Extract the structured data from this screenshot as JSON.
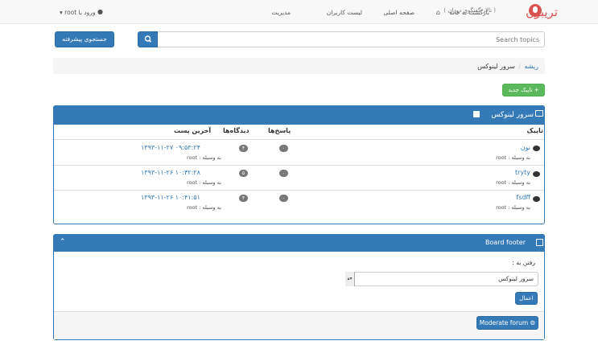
{
  "navbar": {
    "brand": "تریبون",
    "tagline": "( تالار گفتگوی دوران )",
    "items": [
      {
        "label": "بازگشت به خانه",
        "icon": "home-icon"
      },
      {
        "label": "صفحه اصلی"
      },
      {
        "label": "لیست کاربران"
      },
      {
        "label": "مدیریت"
      }
    ],
    "login": "ورود با root ▾",
    "user_icon": "user-icon"
  },
  "search": {
    "placeholder": "Search topics",
    "advanced_label": "جستجوی پیشرفته"
  },
  "breadcrumb": {
    "root": "ریشه",
    "separator": "/",
    "current": "سرور لینوکس"
  },
  "new_topic_label": "+ تاپیک جدید",
  "forum": {
    "title": "سرور لینوکس",
    "columns": {
      "topic": "تاپیک",
      "replies": "پاسخ‌ها",
      "views": "دیدگاه‌ها",
      "last_post": "آخرین پست"
    },
    "rows": [
      {
        "title": "نون",
        "by": "به وسیله : root",
        "replies": "۰",
        "views": "۴",
        "last_date": "۱۳۹۳-۱۱-۲۷ ۰۹:۵۳:۲۴",
        "last_by": "به وسیله : root"
      },
      {
        "title": "tryty",
        "by": "به وسیله : root",
        "replies": "۰",
        "views": "۵",
        "last_date": "۱۳۹۳-۱۱-۲۶ ۱۰:۴۲:۲۸",
        "last_by": "به وسیله : root"
      },
      {
        "title": "fsdff",
        "by": "به وسیله : root",
        "replies": "۰",
        "views": "۴",
        "last_date": "۱۳۹۳-۱۱-۲۶ ۱۰:۴۱:۵۱",
        "last_by": "به وسیله : root"
      }
    ]
  },
  "board_footer": {
    "title": "Board footer",
    "jump_label": "رفتن به :",
    "jump_value": "سرور لینوکس",
    "apply_label": "اعمال",
    "moderate_label": "Moderate forum ⚙"
  },
  "colors": {
    "primary": "#337ab7",
    "success": "#5cb85c",
    "brand": "#d9534f"
  }
}
